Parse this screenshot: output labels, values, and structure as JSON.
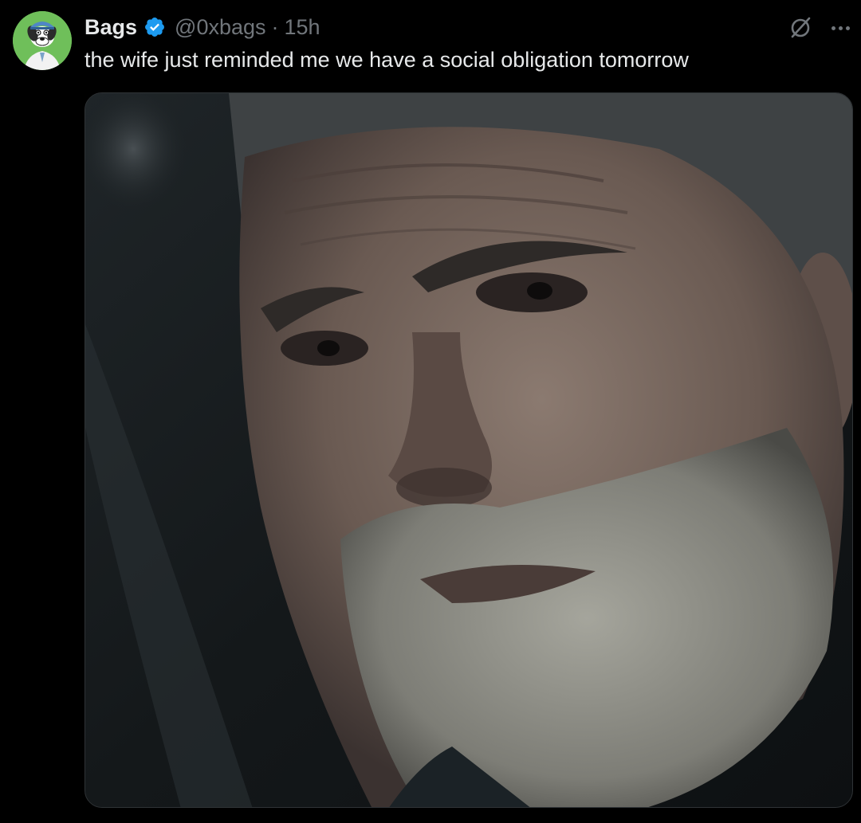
{
  "tweet": {
    "author": {
      "display_name": "Bags",
      "handle": "@0xbags",
      "verified": true,
      "avatar_icon": "cartoon-dog-avatar"
    },
    "separator": "·",
    "timestamp": "15h",
    "text": "the wife just reminded me we have a social obligation tomorrow",
    "media": {
      "kind": "photo",
      "description_icon": "sad-bearded-man-photo"
    },
    "actions": {
      "grok_icon": "grok-icon",
      "more_icon": "more-options-icon"
    }
  },
  "colors": {
    "background": "#000000",
    "text_primary": "#e7e9ea",
    "text_secondary": "#71767b",
    "verified_blue": "#1d9bf0",
    "border": "#2f3336"
  }
}
